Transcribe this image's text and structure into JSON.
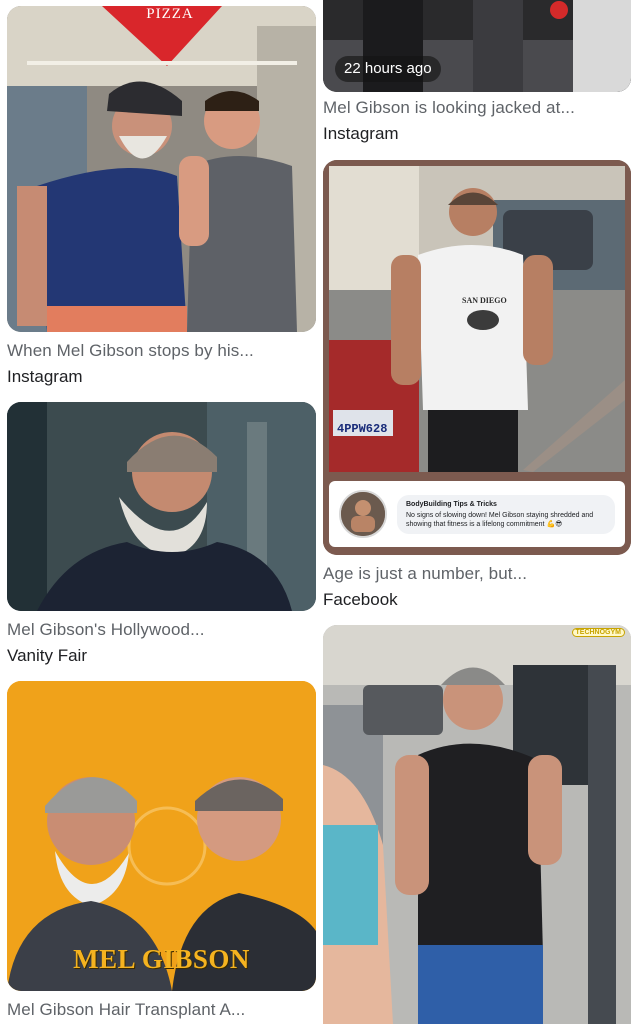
{
  "results": [
    {
      "caption": "When Mel Gibson stops by his...",
      "source": "Instagram",
      "sign_text": "PIZZA"
    },
    {
      "caption": "",
      "source": "",
      "time_badge": "22 hours ago"
    },
    {
      "caption": "Mel Gibson is looking jacked at...",
      "source": "Instagram"
    },
    {
      "caption": "Mel Gibson's Hollywood...",
      "source": "Vanity Fair"
    },
    {
      "caption": "Age is just a number, but...",
      "source": "Facebook",
      "tank_text": "SAN DIEGO",
      "plate_text": "4PPW628",
      "post_author": "BodyBuilding Tips & Tricks",
      "post_text": "No signs of slowing down! Mel Gibson staying shredded and showing that fitness is a lifelong commitment 💪😎"
    },
    {
      "caption": "Mel Gibson Hair Transplant A...",
      "source": "",
      "overlay_title": "MEL GIBSON"
    },
    {
      "caption": "",
      "source": "",
      "gym_brand": "TECHNOGYM"
    }
  ],
  "colors": {
    "caption": "#5f6368",
    "source": "#202124",
    "orange_bg": "#f0a21a",
    "title_gold": "#f5b320"
  }
}
